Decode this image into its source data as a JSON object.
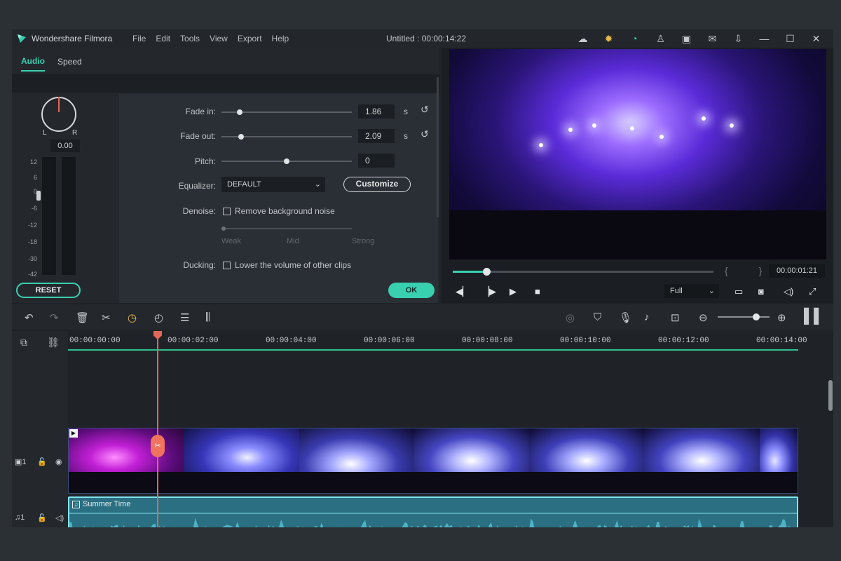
{
  "app": {
    "name": "Wondershare Filmora",
    "menu": [
      "File",
      "Edit",
      "Tools",
      "View",
      "Export",
      "Help"
    ],
    "document_title": "Untitled : 00:00:14:22"
  },
  "panel": {
    "tabs": [
      "Audio",
      "Speed"
    ],
    "active_tab": "Audio",
    "pan": {
      "left_label": "L",
      "right_label": "R",
      "value": "0.00"
    },
    "meter_scale": [
      "12",
      "6",
      "0",
      "-6",
      "-12",
      "-18",
      "-30",
      "-42"
    ],
    "fade_in": {
      "label": "Fade in:",
      "value": "1.86",
      "unit": "s",
      "position": 0.14
    },
    "fade_out": {
      "label": "Fade out:",
      "value": "2.09",
      "unit": "s",
      "position": 0.15
    },
    "pitch": {
      "label": "Pitch:",
      "value": "0",
      "position": 0.5
    },
    "equalizer": {
      "label": "Equalizer:",
      "selected": "DEFAULT",
      "customize_label": "Customize"
    },
    "denoise": {
      "label": "Denoise:",
      "checkbox_label": "Remove background noise",
      "checked": false,
      "levels": [
        "Weak",
        "Mid",
        "Strong"
      ]
    },
    "ducking": {
      "label": "Ducking:",
      "checkbox_label": "Lower the volume of other clips",
      "checked": false
    },
    "reset_label": "RESET",
    "ok_label": "OK"
  },
  "preview": {
    "timecode": "00:00:01:21",
    "progress": 0.13,
    "quality": "Full"
  },
  "timeline": {
    "ruler": [
      "00:00:00:00",
      "00:00:02:00",
      "00:00:04:00",
      "00:00:06:00",
      "00:00:08:00",
      "00:00:10:00",
      "00:00:12:00",
      "00:00:14:00"
    ],
    "video_track_label": "1",
    "audio_track_label": "1",
    "audio_clip_name": "Summer Time"
  },
  "colors": {
    "accent": "#39d0b0",
    "playhead": "#e0685a",
    "audio_clip": "#2a6f82"
  }
}
